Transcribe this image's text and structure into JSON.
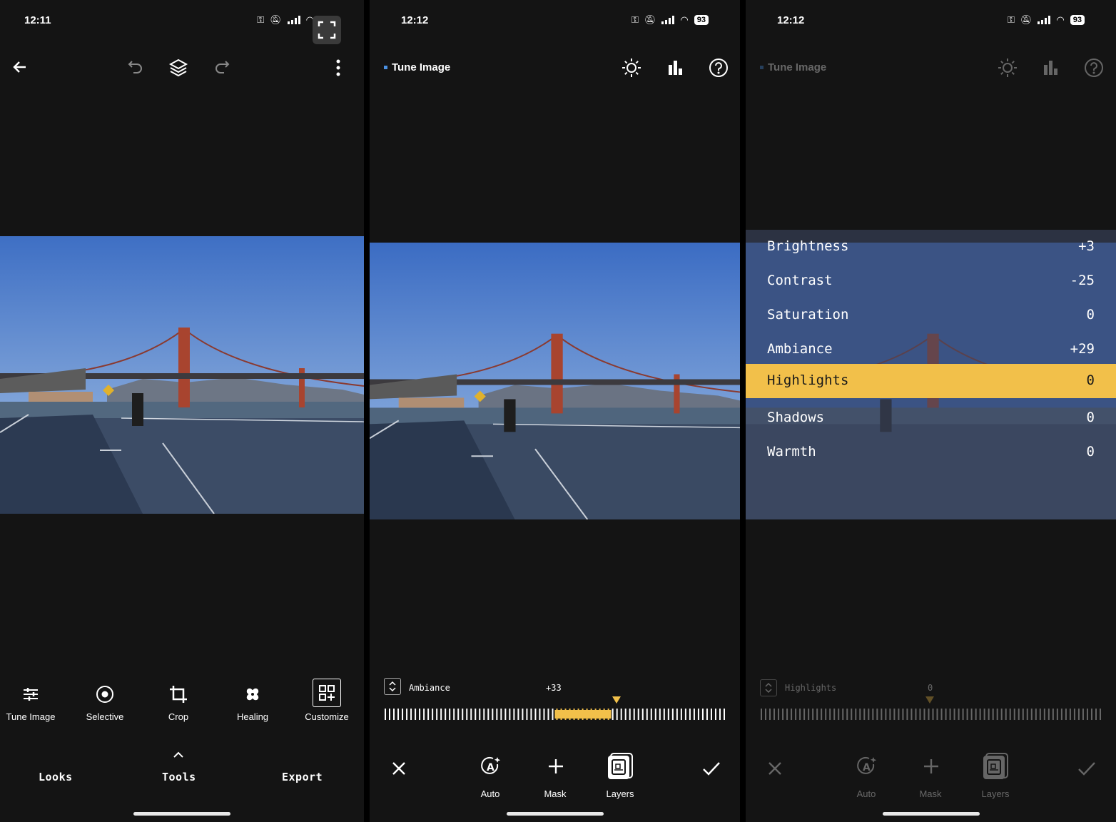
{
  "screen1": {
    "time": "12:11",
    "tools": [
      {
        "label": "Tune Image",
        "icon": "sliders-icon"
      },
      {
        "label": "Selective",
        "icon": "target-icon"
      },
      {
        "label": "Crop",
        "icon": "crop-icon"
      },
      {
        "label": "Healing",
        "icon": "bandage-icon"
      },
      {
        "label": "Customize",
        "icon": "grid-add-icon"
      }
    ],
    "tabs": {
      "looks": "Looks",
      "tools": "Tools",
      "export": "Export"
    }
  },
  "screen2": {
    "time": "12:12",
    "battery": "93",
    "title": "Tune Image",
    "slider": {
      "label": "Ambiance",
      "value": "+33",
      "value_num": 33
    },
    "actions": {
      "auto": "Auto",
      "mask": "Mask",
      "layers": "Layers"
    }
  },
  "screen3": {
    "time": "12:12",
    "battery": "93",
    "title": "Tune Image",
    "menu": [
      {
        "label": "Brightness",
        "value": "+3"
      },
      {
        "label": "Contrast",
        "value": "-25"
      },
      {
        "label": "Saturation",
        "value": "0"
      },
      {
        "label": "Ambiance",
        "value": "+29"
      },
      {
        "label": "Highlights",
        "value": "0"
      },
      {
        "label": "Shadows",
        "value": "0"
      },
      {
        "label": "Warmth",
        "value": "0"
      }
    ],
    "selected_index": 4,
    "slider": {
      "label": "Highlights",
      "value": "0",
      "value_num": 0
    },
    "actions": {
      "auto": "Auto",
      "mask": "Mask",
      "layers": "Layers"
    }
  },
  "colors": {
    "accent": "#f2c04a",
    "title_dot": "#4a90e2"
  }
}
